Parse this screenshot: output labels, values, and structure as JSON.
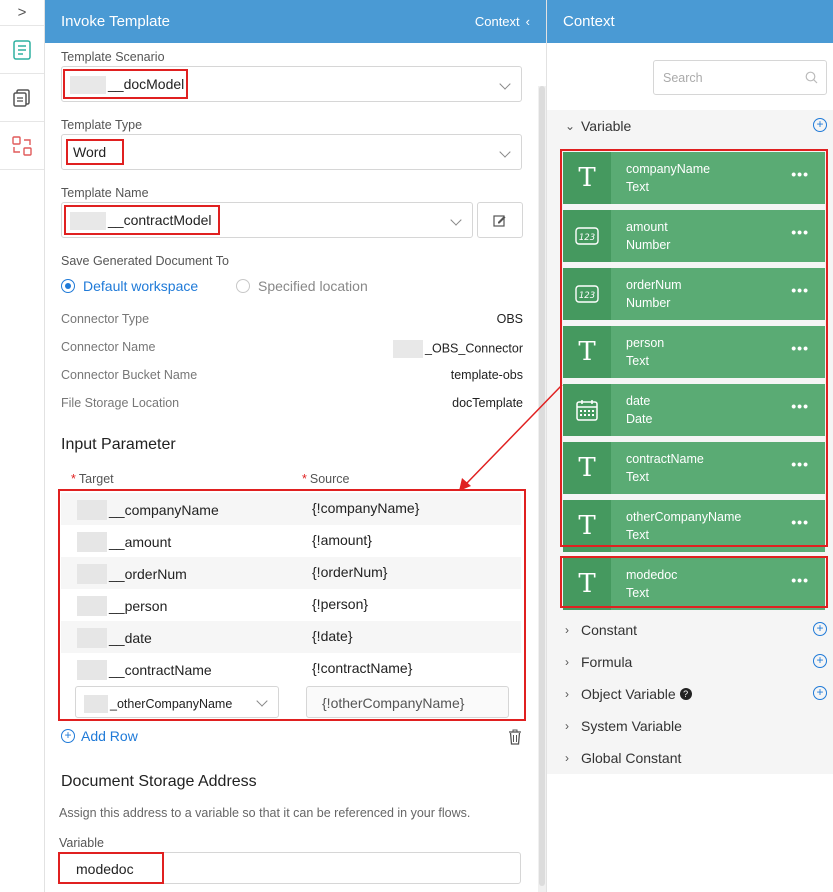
{
  "rail": {
    "expand": ">"
  },
  "mid": {
    "title": "Invoke Template",
    "context_link": "Context",
    "scenario": {
      "label": "Template Scenario",
      "value": "__docModel"
    },
    "type": {
      "label": "Template Type",
      "value": "Word"
    },
    "name": {
      "label": "Template Name",
      "value": "__contractModel"
    },
    "save_to": {
      "label": "Save Generated Document To",
      "option1": "Default workspace",
      "option2": "Specified location"
    },
    "info": [
      {
        "key": "Connector Type",
        "value": "OBS"
      },
      {
        "key": "Connector Name",
        "value": "_OBS_Connector"
      },
      {
        "key": "Connector Bucket Name",
        "value": "template-obs"
      },
      {
        "key": "File Storage Location",
        "value": "docTemplate"
      }
    ],
    "input_param": {
      "title": "Input Parameter",
      "col_target": "Target",
      "col_source": "Source",
      "rows": [
        {
          "target": "__companyName",
          "source": "{!companyName}"
        },
        {
          "target": "__amount",
          "source": "{!amount}"
        },
        {
          "target": "__orderNum",
          "source": "{!orderNum}"
        },
        {
          "target": "__person",
          "source": "{!person}"
        },
        {
          "target": "__date",
          "source": "{!date}"
        },
        {
          "target": "__contractName",
          "source": "{!contractName}"
        }
      ],
      "edit_row": {
        "target": "_otherCompanyName",
        "source": "{!otherCompanyName}"
      },
      "add_row": "Add Row"
    },
    "storage": {
      "title": "Document Storage Address",
      "desc": "Assign this address to a variable so that it can be referenced in your flows.",
      "var_label": "Variable",
      "var_value": "modedoc"
    }
  },
  "right": {
    "title": "Context",
    "search_placeholder": "Search",
    "variable_section": "Variable",
    "variables": [
      {
        "name": "companyName",
        "type": "Text",
        "icon": "text-icon"
      },
      {
        "name": "amount",
        "type": "Number",
        "icon": "number-icon"
      },
      {
        "name": "orderNum",
        "type": "Number",
        "icon": "number-icon"
      },
      {
        "name": "person",
        "type": "Text",
        "icon": "text-icon"
      },
      {
        "name": "date",
        "type": "Date",
        "icon": "calendar-icon"
      },
      {
        "name": "contractName",
        "type": "Text",
        "icon": "text-icon"
      },
      {
        "name": "otherCompanyName",
        "type": "Text",
        "icon": "text-icon"
      },
      {
        "name": "modedoc",
        "type": "Text",
        "icon": "text-icon"
      }
    ],
    "sections": [
      {
        "label": "Constant",
        "has_add": true
      },
      {
        "label": "Formula",
        "has_add": true
      },
      {
        "label": "Object Variable",
        "has_add": true,
        "has_help": true
      },
      {
        "label": "System Variable",
        "has_add": false
      },
      {
        "label": "Global Constant",
        "has_add": false
      }
    ]
  },
  "colors": {
    "header_blue": "#4a9ad4",
    "accent_blue": "#1f7ad8",
    "card_green": "#5aab74",
    "card_icon_green": "#45995f",
    "highlight_red": "#e02020"
  }
}
